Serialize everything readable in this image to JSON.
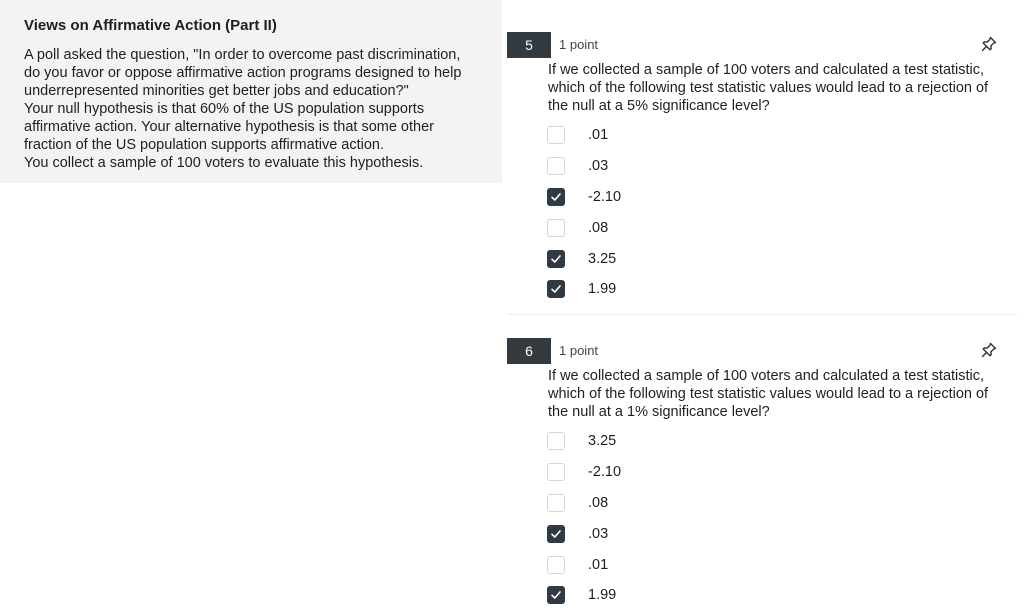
{
  "context": {
    "title": "Views on Affirmative Action (Part II)",
    "paragraphs": [
      "A poll asked the question, \"In order to overcome past discrimination, do you favor or oppose affirmative action programs designed to help underrepresented minorities get better jobs and education?\"",
      "Your null hypothesis is that 60% of the US population supports affirmative action. Your alternative hypothesis is that some other fraction of the US population supports affirmative action.",
      "You collect a sample of 100 voters to evaluate this hypothesis."
    ]
  },
  "questions": [
    {
      "number": "5",
      "points": "1 point",
      "text": "If we collected a sample of 100 voters and calculated a test statistic, which of the following test statistic values would lead to a rejection of the null at a 5% significance level?",
      "options": [
        {
          "label": ".01",
          "checked": false
        },
        {
          "label": ".03",
          "checked": false
        },
        {
          "label": "-2.10",
          "checked": true
        },
        {
          "label": ".08",
          "checked": false
        },
        {
          "label": "3.25",
          "checked": true
        },
        {
          "label": "1.99",
          "checked": true
        }
      ]
    },
    {
      "number": "6",
      "points": "1 point",
      "text": "If we collected a sample of 100 voters and calculated a test statistic, which of the following test statistic values would lead to a rejection of the null at a 1% significance level?",
      "options": [
        {
          "label": "3.25",
          "checked": false
        },
        {
          "label": "-2.10",
          "checked": false
        },
        {
          "label": ".08",
          "checked": false
        },
        {
          "label": ".03",
          "checked": true
        },
        {
          "label": ".01",
          "checked": false
        },
        {
          "label": "1.99",
          "checked": true
        }
      ]
    }
  ],
  "colors": {
    "panel_bg": "#f3f3f3",
    "badge_bg": "#333a40",
    "checkbox_checked": "#2f3a44",
    "checkbox_border": "#d6d6d6"
  },
  "icons": {
    "pin": "pin-icon",
    "check": "check-icon"
  }
}
